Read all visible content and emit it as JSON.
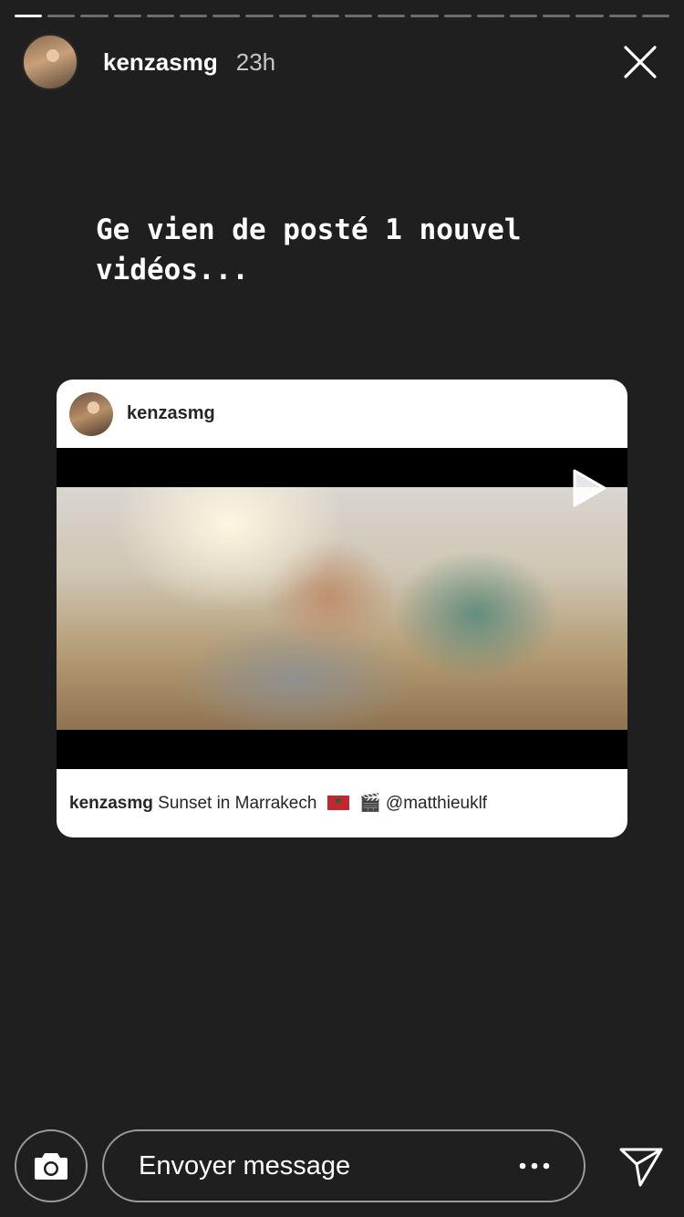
{
  "story": {
    "segments_total": 20,
    "active_segment": 0
  },
  "header": {
    "username": "kenzasmg",
    "time": "23h"
  },
  "text": "Ge vien de posté 1 nouvel\nvidéos...",
  "card": {
    "username": "kenzasmg",
    "caption_user": "kenzasmg",
    "caption_text": "Sunset in Marrakech",
    "caption_mention": "@matthieuklf"
  },
  "footer": {
    "placeholder": "Envoyer message"
  },
  "icons": {
    "close": "close-icon",
    "play": "play-icon",
    "camera": "camera-icon",
    "more": "more-icon",
    "send": "send-icon",
    "flag": "morocco-flag-emoji",
    "clapper": "clapper-board-emoji"
  }
}
